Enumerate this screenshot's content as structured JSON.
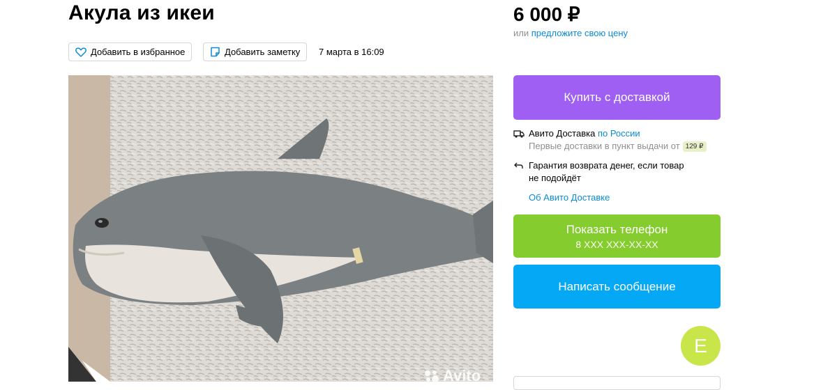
{
  "listing": {
    "title": "Акула из икеи",
    "date": "7 марта в 16:09",
    "favorite_label": "Добавить в избранное",
    "note_label": "Добавить заметку",
    "photo_watermark": "Avito"
  },
  "pricing": {
    "price": "6 000 ₽",
    "offer_prefix": "или ",
    "offer_link": "предложите свою цену"
  },
  "actions": {
    "buy_label": "Купить с доставкой",
    "phone_label": "Показать телефон",
    "phone_number": "8 XXX XXX-XX-XX",
    "message_label": "Написать сообщение"
  },
  "delivery": {
    "service": "Авито Доставка ",
    "scope": "по России",
    "first_delivery": "Первые доставки в пункт выдачи от",
    "first_delivery_price": "129 ₽",
    "guarantee_line1": "Гарантия возврата денег, если товар",
    "guarantee_line2": "не подойдёт",
    "about_link": "Об Авито Доставке"
  },
  "seller": {
    "avatar_letter": "Е"
  },
  "colors": {
    "buy": "#9e5ff2",
    "phone": "#85cc2e",
    "message": "#04a8f5",
    "link": "#0a8bd8",
    "avatar": "#c8e64a"
  }
}
